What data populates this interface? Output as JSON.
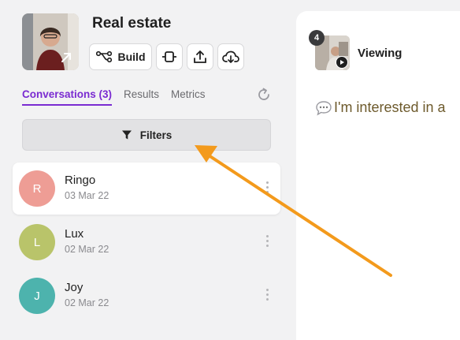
{
  "workspace": {
    "title": "Real estate",
    "avatar_alt": "workspace avatar"
  },
  "toolbar": {
    "build_label": "Build",
    "icons": [
      "flow-icon",
      "integration-icon",
      "upload-icon",
      "cloud-download-icon"
    ]
  },
  "tabs": [
    {
      "label": "Conversations (3)",
      "active": true
    },
    {
      "label": "Results",
      "active": false
    },
    {
      "label": "Metrics",
      "active": false
    }
  ],
  "filters": {
    "label": "Filters"
  },
  "conversations": [
    {
      "initial": "R",
      "name": "Ringo",
      "date": "03 Mar 22",
      "color": "#ee9d95",
      "selected": true
    },
    {
      "initial": "L",
      "name": "Lux",
      "date": "02 Mar 22",
      "color": "#b9c46a",
      "selected": false
    },
    {
      "initial": "J",
      "name": "Joy",
      "date": "02 Mar 22",
      "color": "#4db3ad",
      "selected": false
    }
  ],
  "detail": {
    "badge_count": "4",
    "status_label": "Viewing",
    "message": "I'm interested in a"
  },
  "colors": {
    "accent": "#7a2bd1",
    "annotation_arrow": "#f39a1c"
  }
}
